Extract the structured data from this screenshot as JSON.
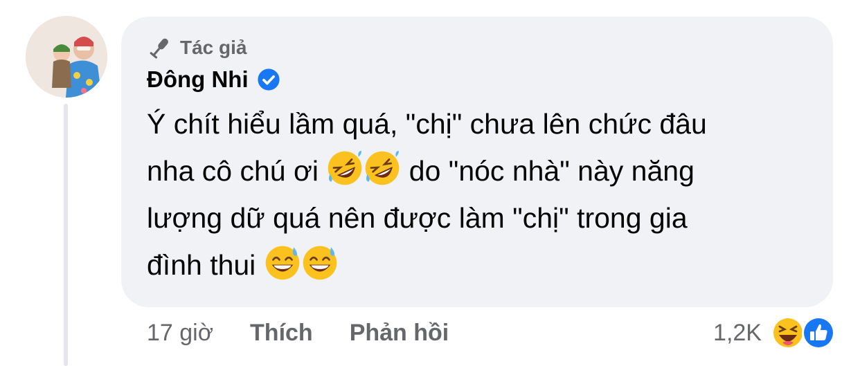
{
  "comment": {
    "author_badge": "Tác giả",
    "author_name": "Đông Nhi",
    "text": {
      "line1": "Ý chít hiểu lầm quá, \"chị\" chưa lên chức đâu",
      "line2_before_emoji": "nha cô chú ơi ",
      "line2_after_emoji": " do \"nóc nhà\" này năng",
      "line3": "lượng dữ quá nên được làm \"chị\" trong gia",
      "line4": "đình thui "
    },
    "emojis": [
      "rolling-on-floor-laughing",
      "rolling-on-floor-laughing",
      "grinning-sweat",
      "grinning-sweat"
    ]
  },
  "footer": {
    "time": "17 giờ",
    "like_label": "Thích",
    "reply_label": "Phản hồi"
  },
  "reactions": {
    "count": "1,2K",
    "types": [
      "haha",
      "like"
    ]
  },
  "colors": {
    "bubble": "#f0f2f5",
    "verified": "#1877f2",
    "muted_text": "#65676b"
  }
}
